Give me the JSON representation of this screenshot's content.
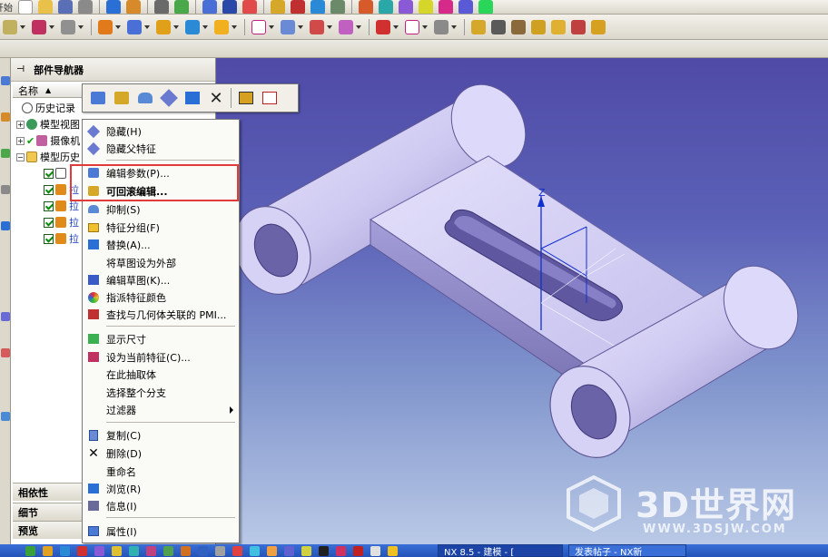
{
  "toolbar_top": {
    "label": "开始"
  },
  "navigator": {
    "title": "部件导航器",
    "column_header": "名称",
    "tree": [
      {
        "label": "历史记录",
        "level": 0
      },
      {
        "label": "模型视图",
        "level": 0
      },
      {
        "label": "摄像机",
        "level": 0
      },
      {
        "label": "模型历史",
        "level": 0
      },
      {
        "label": "",
        "level": 1
      },
      {
        "label": "拉",
        "level": 1
      },
      {
        "label": "拉",
        "level": 1
      },
      {
        "label": "拉",
        "level": 1
      },
      {
        "label": "拉",
        "level": 1
      }
    ],
    "bottom_tabs": [
      "相依性",
      "细节",
      "预览"
    ]
  },
  "context_menu": {
    "items": [
      {
        "label": "隐藏(H)",
        "icon": "hide-icon"
      },
      {
        "label": "隐藏父特征",
        "icon": "hide-parent-icon"
      },
      {
        "label": "编辑参数(P)...",
        "icon": "edit-params-icon"
      },
      {
        "label": "可回滚编辑...",
        "icon": "rollback-edit-icon",
        "bold": true
      },
      {
        "label": "抑制(S)",
        "icon": "suppress-icon"
      },
      {
        "label": "特征分组(F)",
        "icon": "feature-group-icon"
      },
      {
        "label": "替换(A)...",
        "icon": "replace-icon"
      },
      {
        "label": "将草图设为外部",
        "icon": ""
      },
      {
        "label": "编辑草图(K)...",
        "icon": "edit-sketch-icon"
      },
      {
        "label": "指派特征颜色",
        "icon": "color-icon"
      },
      {
        "label": "查找与几何体关联的 PMI...",
        "icon": "pmi-icon"
      },
      {
        "label": "显示尺寸",
        "icon": "show-dimension-icon"
      },
      {
        "label": "设为当前特征(C)...",
        "icon": "current-feature-icon"
      },
      {
        "label": "在此抽取体",
        "icon": ""
      },
      {
        "label": "选择整个分支",
        "icon": ""
      },
      {
        "label": "过滤器",
        "icon": "",
        "submenu": true
      },
      {
        "label": "复制(C)",
        "icon": "copy-icon"
      },
      {
        "label": "删除(D)",
        "icon": "delete-icon"
      },
      {
        "label": "重命名",
        "icon": ""
      },
      {
        "label": "浏览(R)",
        "icon": "browse-icon"
      },
      {
        "label": "信息(I)",
        "icon": "info-icon"
      },
      {
        "label": "属性(I)",
        "icon": "properties-icon"
      }
    ]
  },
  "viewport": {
    "axis_label": "Z"
  },
  "watermark": {
    "brand": "3D世界网",
    "url": "WWW.3DSJW.COM"
  },
  "taskbar": {
    "tasks": [
      "NX 8.5 - 建模 - [",
      "发表帖子 - NX新"
    ]
  },
  "colors": {
    "highlight_box": "#e23a3a",
    "viewport_top": "#4f4aa6",
    "model_face": "#d8d4f4"
  }
}
